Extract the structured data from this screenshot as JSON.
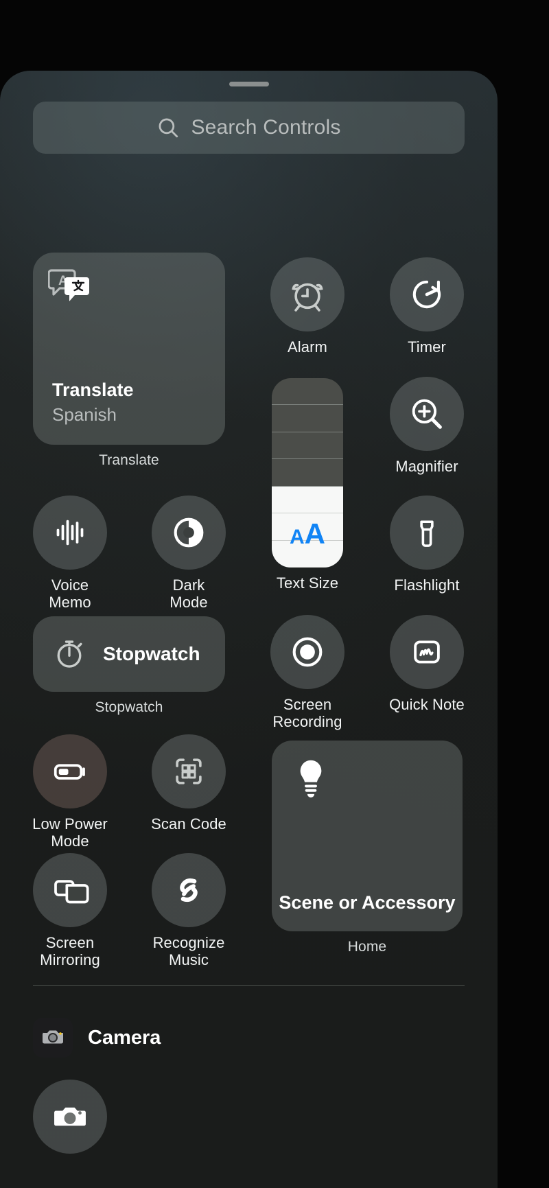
{
  "sheet": {
    "grabber": "drag-handle"
  },
  "search": {
    "placeholder": "Search Controls",
    "icon": "search-icon"
  },
  "controls": {
    "translate": {
      "title": "Translate",
      "subtitle": "Spanish",
      "caption": "Translate",
      "icon": "translate-icon"
    },
    "alarm": {
      "label": "Alarm",
      "icon": "alarm-clock-icon"
    },
    "timer": {
      "label": "Timer",
      "icon": "timer-icon"
    },
    "magnifier": {
      "label": "Magnifier",
      "icon": "magnifier-plus-icon"
    },
    "voice_memo": {
      "label": "Voice Memo",
      "icon": "waveform-icon"
    },
    "dark_mode": {
      "label": "Dark Mode",
      "icon": "contrast-circle-icon"
    },
    "text_size": {
      "label": "Text Size",
      "icon": "text-size-aa-icon",
      "aa_small": "A",
      "aa_large": "A",
      "segments": 7,
      "filled_segments": 3,
      "accent": "#1184f5"
    },
    "flashlight": {
      "label": "Flashlight",
      "icon": "flashlight-icon"
    },
    "stopwatch": {
      "title": "Stopwatch",
      "caption": "Stopwatch",
      "icon": "stopwatch-icon"
    },
    "screen_recording": {
      "label": "Screen\nRecording",
      "icon": "record-circle-icon"
    },
    "quick_note": {
      "label": "Quick Note",
      "icon": "quick-note-icon"
    },
    "low_power_mode": {
      "label": "Low Power\nMode",
      "icon": "battery-icon"
    },
    "scan_code": {
      "label": "Scan Code",
      "icon": "qr-scan-icon"
    },
    "screen_mirroring": {
      "label": "Screen\nMirroring",
      "icon": "screen-mirroring-icon"
    },
    "recognize_music": {
      "label": "Recognize\nMusic",
      "icon": "shazam-icon"
    },
    "home": {
      "title": "Scene or Accessory",
      "caption": "Home",
      "icon": "lightbulb-icon"
    }
  },
  "app_section": {
    "camera": {
      "name": "Camera",
      "icon": "camera-app-icon"
    },
    "camera_control": {
      "icon": "camera-icon"
    }
  },
  "colors": {
    "accent_blue": "#1184f5",
    "tile_fill": "#747c7a",
    "sheet_bg": "#22252 3",
    "text_primary": "#f2f4f4",
    "text_secondary": "#b9bdbd"
  }
}
